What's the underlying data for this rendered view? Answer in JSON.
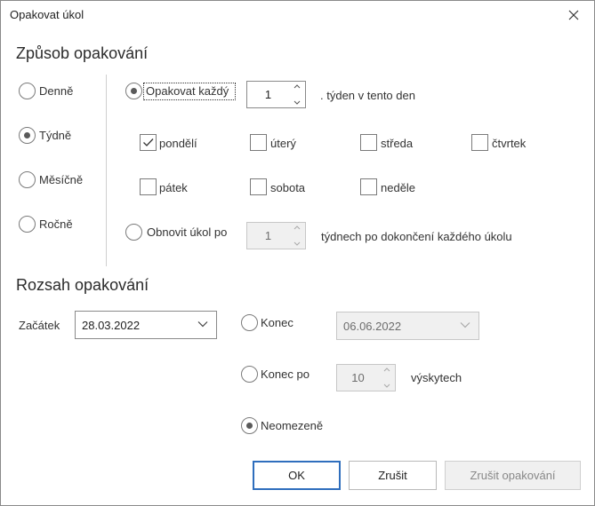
{
  "window": {
    "title": "Opakovat úkol"
  },
  "pattern": {
    "title": "Způsob opakování",
    "frequencies": [
      {
        "label": "Denně",
        "checked": false
      },
      {
        "label": "Týdně",
        "checked": true
      },
      {
        "label": "Měsíčně",
        "checked": false
      },
      {
        "label": "Ročně",
        "checked": false
      }
    ],
    "repeat_every": {
      "label": "Opakovat každý",
      "value": "1",
      "suffix": ". týden v tento den",
      "checked": true
    },
    "days": [
      {
        "label": "pondělí",
        "checked": true
      },
      {
        "label": "úterý",
        "checked": false
      },
      {
        "label": "středa",
        "checked": false
      },
      {
        "label": "čtvrtek",
        "checked": false
      },
      {
        "label": "pátek",
        "checked": false
      },
      {
        "label": "sobota",
        "checked": false
      },
      {
        "label": "neděle",
        "checked": false
      }
    ],
    "regenerate": {
      "label": "Obnovit úkol po",
      "value": "1",
      "suffix": "týdnech po dokončení každého úkolu",
      "checked": false
    }
  },
  "range": {
    "title": "Rozsah opakování",
    "start_label": "Začátek",
    "start_value": "28.03.2022",
    "end_by": {
      "label": "Konec",
      "value": "06.06.2022",
      "checked": false
    },
    "end_after": {
      "label": "Konec po",
      "value": "10",
      "suffix": "výskytech",
      "checked": false
    },
    "no_end": {
      "label": "Neomezeně",
      "checked": true
    }
  },
  "buttons": {
    "ok": "OK",
    "cancel": "Zrušit",
    "remove": "Zrušit opakování"
  },
  "colors": {
    "accent": "#2f6ebd",
    "border": "#8a8a8a",
    "disabled_bg": "#f0f0f0"
  }
}
